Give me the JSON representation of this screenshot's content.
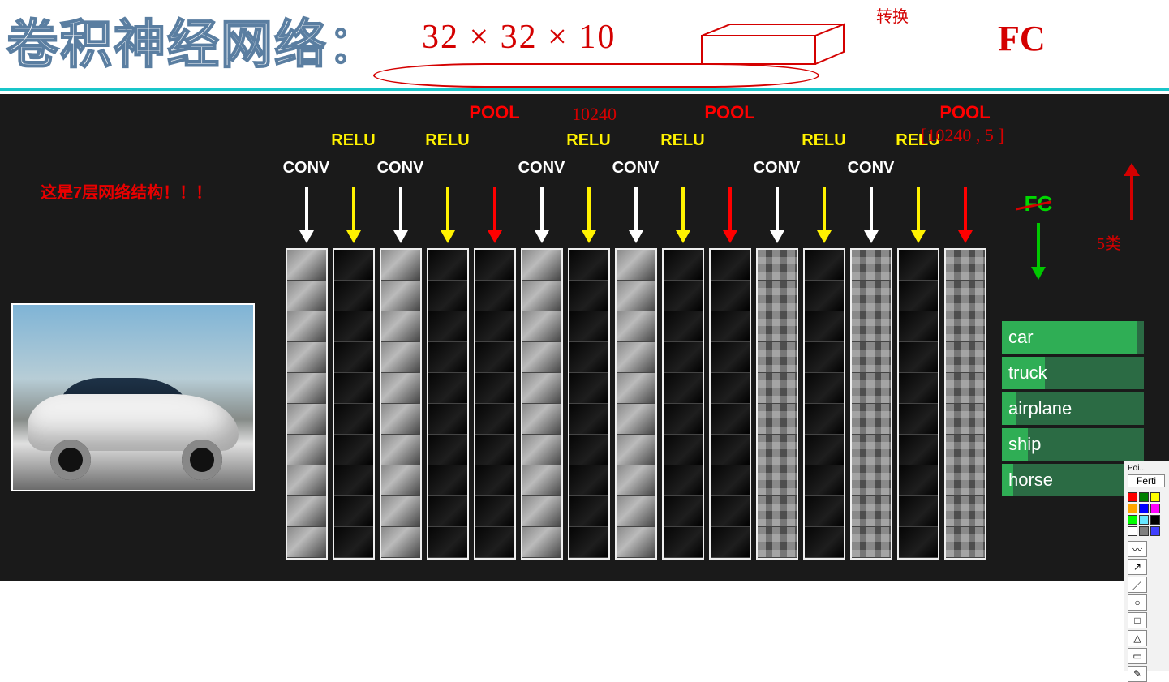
{
  "header": {
    "title": "卷积神经网络：",
    "hand_dims": "32 × 32 × 10",
    "zhuanhuan": "转换",
    "fc": "FC"
  },
  "note1": "这是7层网络结构！！！",
  "layers": [
    {
      "top": "",
      "mid": "",
      "bot": "CONV",
      "arrow": "white",
      "style": "light"
    },
    {
      "top": "",
      "mid": "RELU",
      "bot": "",
      "arrow": "yellow",
      "style": "dark"
    },
    {
      "top": "",
      "mid": "",
      "bot": "CONV",
      "arrow": "white",
      "style": "light"
    },
    {
      "top": "",
      "mid": "RELU",
      "bot": "",
      "arrow": "yellow",
      "style": "dark"
    },
    {
      "top": "POOL",
      "mid": "",
      "bot": "",
      "arrow": "red",
      "style": "dark"
    },
    {
      "top": "",
      "mid": "",
      "bot": "CONV",
      "arrow": "white",
      "style": "light"
    },
    {
      "top": "",
      "mid": "RELU",
      "bot": "",
      "arrow": "yellow",
      "style": "dark"
    },
    {
      "top": "",
      "mid": "",
      "bot": "CONV",
      "arrow": "white",
      "style": "light"
    },
    {
      "top": "",
      "mid": "RELU",
      "bot": "",
      "arrow": "yellow",
      "style": "dark"
    },
    {
      "top": "POOL",
      "mid": "",
      "bot": "",
      "arrow": "red",
      "style": "dark"
    },
    {
      "top": "",
      "mid": "",
      "bot": "CONV",
      "arrow": "white",
      "style": "pix"
    },
    {
      "top": "",
      "mid": "RELU",
      "bot": "",
      "arrow": "yellow",
      "style": "dark"
    },
    {
      "top": "",
      "mid": "",
      "bot": "CONV",
      "arrow": "white",
      "style": "pix"
    },
    {
      "top": "",
      "mid": "RELU",
      "bot": "",
      "arrow": "yellow",
      "style": "dark"
    },
    {
      "top": "POOL",
      "mid": "",
      "bot": "",
      "arrow": "red",
      "style": "pix"
    }
  ],
  "filters_per_col": 10,
  "fc_label": "FC",
  "hand2": {
    "tenk1": "10240",
    "tenk2": "[10240 , 5 ]",
    "fiveclass": "5类"
  },
  "predictions": [
    {
      "label": "car",
      "score": 0.95
    },
    {
      "label": "truck",
      "score": 0.3
    },
    {
      "label": "airplane",
      "score": 0.1
    },
    {
      "label": "ship",
      "score": 0.18
    },
    {
      "label": "horse",
      "score": 0.08
    }
  ],
  "toolbox": {
    "title": "Poi...",
    "button": "Ferti",
    "colors": [
      "#ff0000",
      "#008000",
      "#ffff00",
      "#ffa500",
      "#0000ff",
      "#ff00ff",
      "#00ff00",
      "#66e6ff",
      "#000000",
      "#ffffff",
      "#808080",
      "#4040ff"
    ],
    "tools": [
      "〰",
      "↗",
      "／",
      "○",
      "□",
      "△",
      "▭",
      "✎"
    ]
  }
}
